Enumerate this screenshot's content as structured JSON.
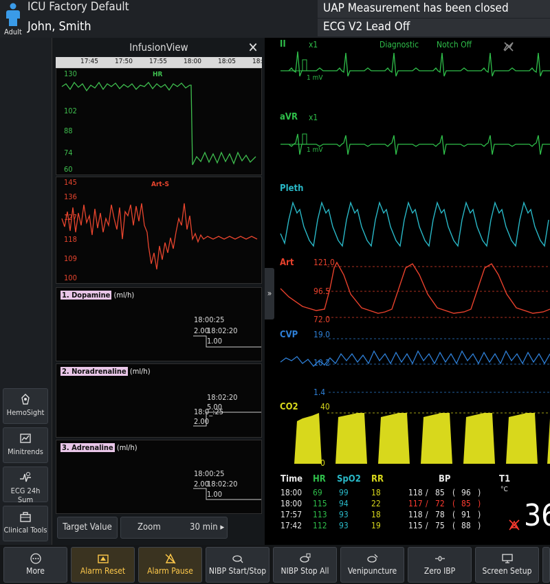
{
  "header": {
    "category": "Adult",
    "profile": "ICU  Factory Default",
    "patient_name": "John, Smith",
    "messages": [
      "UAP Measurement has been closed",
      "ECG V2 Lead Off"
    ]
  },
  "left_dock": [
    {
      "label": "HemoSight",
      "icon": "hemosight-icon"
    },
    {
      "label": "Minitrends",
      "icon": "minitrends-icon"
    },
    {
      "label": "ECG 24h Sum",
      "icon": "ecg-summary-icon"
    },
    {
      "label": "Clinical Tools",
      "icon": "toolbox-icon"
    }
  ],
  "infusion_view": {
    "title": "InfusionView",
    "times": [
      "17:45",
      "17:50",
      "17:55",
      "18:00",
      "18:05",
      "18:"
    ],
    "hr_panel": {
      "title": "HR",
      "color": "#3fbf4f",
      "yticks": [
        "130",
        "102",
        "88",
        "74",
        "60"
      ]
    },
    "arts_panel": {
      "title": "Art-S",
      "color": "#e8452e",
      "yticks": [
        "145",
        "136",
        "127",
        "118",
        "109",
        "100"
      ]
    },
    "drugs": [
      {
        "name": "1. Dopamine",
        "unit": "(ml/h)",
        "t1": "18:00:25",
        "v1": "2.00",
        "t2": "18:02:20",
        "v2": "1.00"
      },
      {
        "name": "2. Noradrenaline",
        "unit": "(ml/h)",
        "t1": "18:02:20",
        "v1": "5.00",
        "t2": "18:0_:25",
        "v2": "2.00"
      },
      {
        "name": "3. Adrenaline",
        "unit": "(ml/h)",
        "t1": "18:00:25",
        "v1": "2.00",
        "t2": "18:02:20",
        "v2": "1.00"
      }
    ],
    "buttons": {
      "target": "Target Value",
      "zoom": "Zoom",
      "zoom_value": "30 min ▸"
    }
  },
  "waveforms": {
    "ii": {
      "label": "II",
      "scale": "x1",
      "mode": "Diagnostic",
      "filter": "Notch Off",
      "unit": "1 mV"
    },
    "avr": {
      "label": "aVR",
      "scale": "x1",
      "unit": "1 mV"
    },
    "pleth": {
      "label": "Pleth"
    },
    "art": {
      "label": "Art",
      "high": "121.0",
      "mid": "96.5",
      "low": "72.0"
    },
    "cvp": {
      "label": "CVP",
      "high": "19.0",
      "mid": "10.2",
      "low": "1.4"
    },
    "co2": {
      "label": "CO2",
      "high": "40",
      "low": "0"
    }
  },
  "trend_table": {
    "headers": {
      "time": "Time",
      "hr": "HR",
      "spo2": "SpO2",
      "rr": "RR",
      "bp": "BP"
    },
    "rows": [
      {
        "time": "18:00",
        "hr": "69",
        "spo2": "99",
        "rr": "18",
        "sys": "118",
        "dia": "85",
        "mean": "96",
        "alarm": false
      },
      {
        "time": "18:00",
        "hr": "115",
        "spo2": "94",
        "rr": "22",
        "sys": "117",
        "dia": "72",
        "mean": "85",
        "alarm": true
      },
      {
        "time": "17:57",
        "hr": "113",
        "spo2": "93",
        "rr": "18",
        "sys": "118",
        "dia": "78",
        "mean": "91",
        "alarm": false
      },
      {
        "time": "17:42",
        "hr": "112",
        "spo2": "93",
        "rr": "19",
        "sys": "115",
        "dia": "75",
        "mean": "88",
        "alarm": false
      }
    ]
  },
  "temperature": {
    "label": "T1",
    "unit": "°C",
    "value": "36"
  },
  "bottom_bar": [
    {
      "label": "More",
      "icon": "more-icon"
    },
    {
      "label": "Alarm Reset",
      "icon": "alarm-reset-icon"
    },
    {
      "label": "Alarm Pause",
      "icon": "alarm-pause-icon"
    },
    {
      "label": "NIBP Start/Stop",
      "icon": "nibp-start-icon"
    },
    {
      "label": "NIBP Stop All",
      "icon": "nibp-stop-all-icon"
    },
    {
      "label": "Venipuncture",
      "icon": "venipuncture-icon"
    },
    {
      "label": "Zero IBP",
      "icon": "zero-ibp-icon"
    },
    {
      "label": "Screen Setup",
      "icon": "screen-setup-icon"
    }
  ],
  "colors": {
    "ecg": "#2fbf4a",
    "pleth": "#29b8c7",
    "art": "#e8412c",
    "cvp": "#2e7fd6",
    "co2": "#d8d81c",
    "alarm_yellow": "#ffc94a",
    "alarm_red": "#ff3b30"
  }
}
